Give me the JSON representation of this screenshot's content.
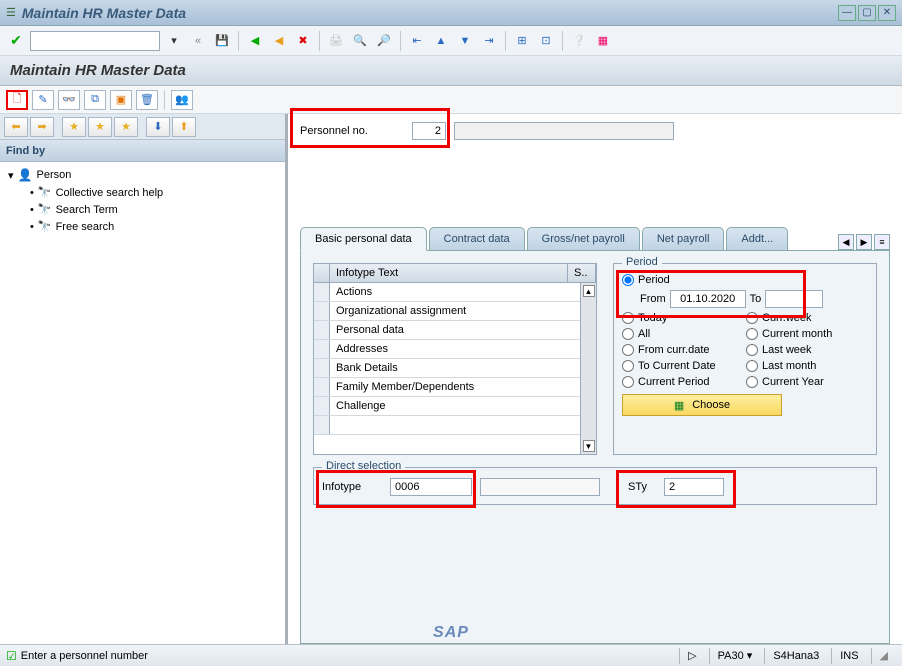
{
  "window": {
    "title": "Maintain HR Master Data"
  },
  "page": {
    "title": "Maintain HR Master Data"
  },
  "personnel": {
    "label": "Personnel no.",
    "value": "2"
  },
  "findby": {
    "header": "Find by",
    "tree": {
      "root": "Person",
      "children": [
        "Collective search help",
        "Search Term",
        "Free search"
      ]
    }
  },
  "tabs": [
    "Basic personal data",
    "Contract data",
    "Gross/net payroll",
    "Net payroll",
    "Addt..."
  ],
  "active_tab": 0,
  "infotype_table": {
    "header_text": "Infotype Text",
    "header_s": "S..",
    "rows": [
      "Actions",
      "Organizational assignment",
      "Personal data",
      "Addresses",
      "Bank Details",
      "Family Member/Dependents",
      "Challenge"
    ]
  },
  "period": {
    "group_label": "Period",
    "radio_period": "Period",
    "from_label": "From",
    "from_value": "01.10.2020",
    "to_label": "To",
    "radio_today": "Today",
    "radio_currweek": "Curr.week",
    "radio_all": "All",
    "radio_currmonth": "Current month",
    "radio_fromcurr": "From curr.date",
    "radio_lastweek": "Last week",
    "radio_tocurrent": "To Current Date",
    "radio_lastmonth": "Last month",
    "radio_currperiod": "Current Period",
    "radio_curryear": "Current Year",
    "choose": "Choose"
  },
  "direct_selection": {
    "group_label": "Direct selection",
    "infotype_label": "Infotype",
    "infotype_value": "0006",
    "sty_label": "STy",
    "sty_value": "2"
  },
  "status": {
    "message": "Enter a personnel number",
    "tcode": "PA30",
    "system": "S4Hana3",
    "mode": "INS"
  }
}
